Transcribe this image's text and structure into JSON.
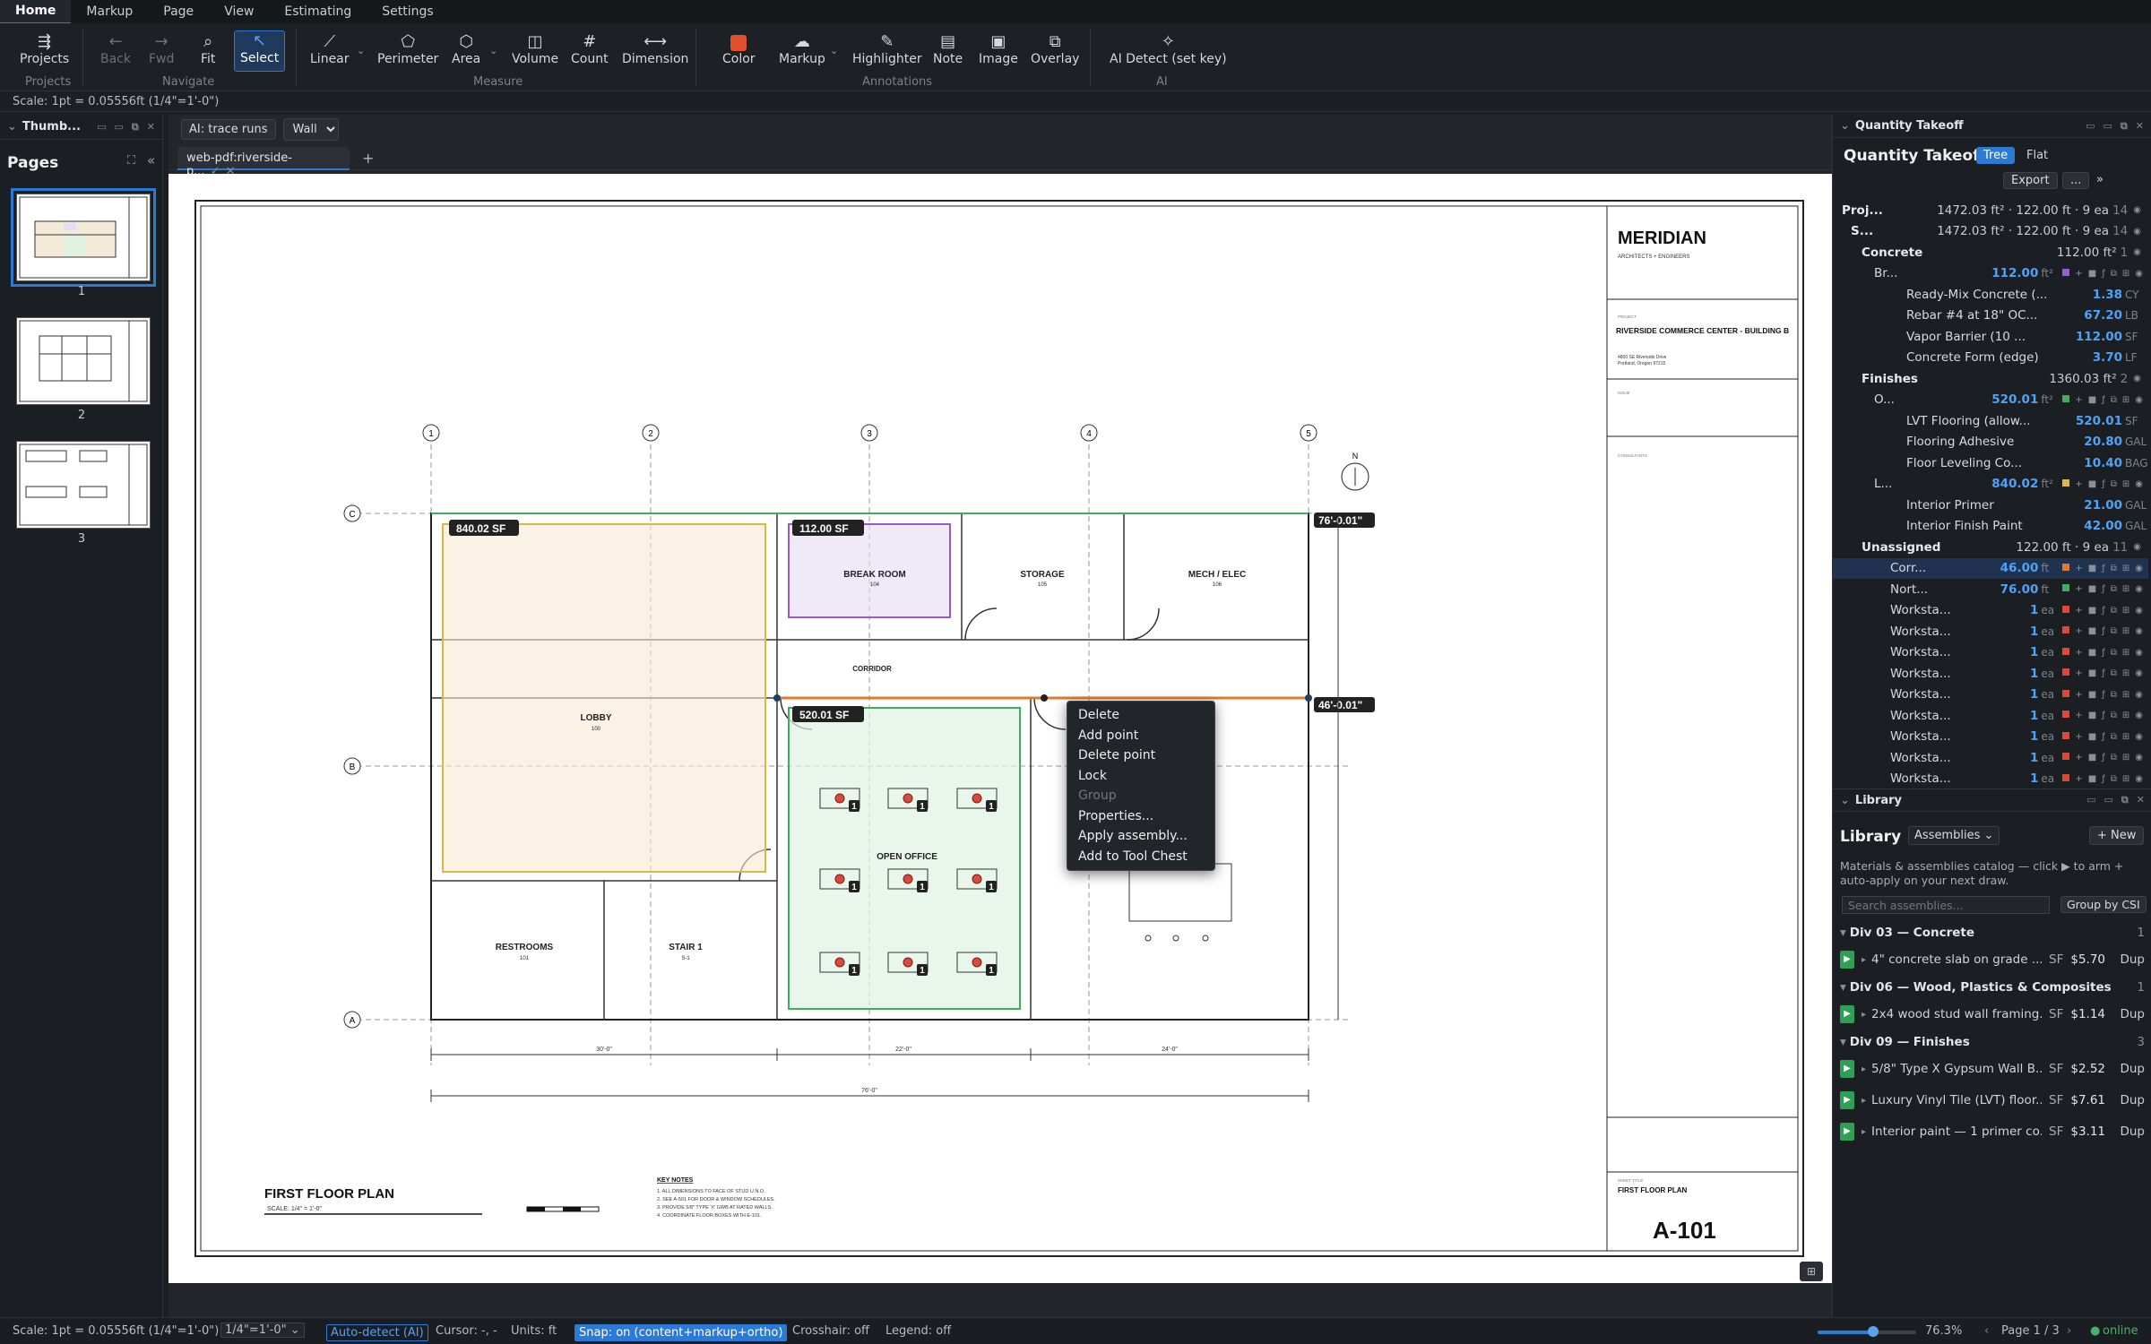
{
  "menu": [
    "Home",
    "Markup",
    "Page",
    "View",
    "Estimating",
    "Settings"
  ],
  "ribbon": {
    "projects": "Projects",
    "back": "Back",
    "fwd": "Fwd",
    "fit": "Fit",
    "select": "Select",
    "linear": "Linear",
    "perimeter": "Perimeter",
    "area": "Area",
    "volume": "Volume",
    "count": "Count",
    "dimension": "Dimension",
    "color": "Color",
    "markup": "Markup",
    "highlighter": "Highlighter",
    "note": "Note",
    "image": "Image",
    "overlay": "Overlay",
    "ai_detect": "AI Detect (set key)",
    "groups": {
      "projects": "Projects",
      "navigate": "Navigate",
      "measure": "Measure",
      "annotations": "Annotations",
      "ai": "AI"
    }
  },
  "scale_line": "Scale: 1pt = 0.05556ft (1/4\"=1'-0\")",
  "left_panel": {
    "title": "Thumb...",
    "pages_title": "Pages",
    "pages": [
      "1",
      "2",
      "3"
    ]
  },
  "viewer": {
    "ai_button": "AI: trace runs",
    "wall_select": "Wall",
    "tab_label": "web-pdf:riverside-p...",
    "measurements": {
      "lobby": "840.02 SF",
      "breakroom": "112.00 SF",
      "openoffice": "520.01 SF",
      "dim_top": "76'-0.01\"",
      "dim_mid": "46'-0.01\""
    }
  },
  "plan": {
    "grid_cols": [
      "1",
      "2",
      "3",
      "4",
      "5"
    ],
    "grid_rows": [
      "C",
      "B",
      "A"
    ],
    "rooms": {
      "lobby": "LOBBY",
      "lobby_no": "100",
      "breakroom": "BREAK ROOM",
      "breakroom_no": "104",
      "storage": "STORAGE",
      "storage_no": "105",
      "mech": "MECH / ELEC",
      "mech_no": "106",
      "corridor": "CORRIDOR",
      "openoffice": "OPEN OFFICE",
      "restrooms": "RESTROOMS",
      "restrooms_no": "101",
      "stair": "STAIR 1",
      "stair_no": "S-1"
    },
    "dims": {
      "d1": "30'-0\"",
      "d2": "22'-0\"",
      "d3": "24'-0\"",
      "total": "76'-0\""
    },
    "title": "FIRST FLOOR PLAN",
    "scale": "SCALE: 1/4\" = 1'-0\"",
    "key_notes_title": "KEY NOTES",
    "key_notes": [
      "1. ALL DIMENSIONS TO FACE OF STUD U.N.O.",
      "2. SEE A-501 FOR DOOR & WINDOW SCHEDULES.",
      "3. PROVIDE 5/8\" TYPE 'X' GWB AT RATED WALLS.",
      "4. COORDINATE FLOOR BOXES WITH E-101."
    ],
    "workstation_count": "1",
    "north": "N"
  },
  "titleblock": {
    "firm": "MERIDIAN",
    "firm_sub": "ARCHITECTS + ENGINEERS",
    "project_label": "PROJECT",
    "project": "RIVERSIDE COMMERCE CENTER - BUILDING B",
    "project_addr": "4800 SE Riverside Drive",
    "project_city": "Portland, Oregon 97215",
    "issue_label": "ISSUE",
    "consultants_label": "CONSULTANTS",
    "sheet_title_label": "SHEET TITLE",
    "sheet_title": "FIRST FLOOR PLAN",
    "sheet_no": "A-101"
  },
  "context_menu": [
    "Delete",
    "Add point",
    "Delete point",
    "Lock",
    "Group",
    "Properties...",
    "Apply assembly...",
    "Add to Tool Chest"
  ],
  "status": {
    "scale": "Scale: 1pt = 0.05556ft (1/4\"=1'-0\")",
    "scale_select": "1/4\"=1'-0\"",
    "auto_detect": "Auto-detect (AI)",
    "cursor": "Cursor: -, -",
    "units": "Units: ft",
    "snap": "Snap: on (content+markup+ortho)",
    "crosshair": "Crosshair: off",
    "legend": "Legend: off",
    "zoom": "76.3%",
    "page": "Page 1 / 3",
    "online": "online"
  },
  "takeoff": {
    "panel_title": "Quantity Takeoff",
    "title": "Quantity Takeoff",
    "tree": "Tree",
    "flat": "Flat",
    "export": "Export",
    "more": "...",
    "rows": [
      {
        "lbl": "Proj...",
        "sum": "1472.03 ft² · 122.00 ft · 9 ea",
        "n": "14",
        "ind": 10,
        "bold": true
      },
      {
        "lbl": "S...",
        "sum": "1472.03 ft² · 122.00 ft · 9 ea",
        "n": "14",
        "ind": 20,
        "bold": true
      },
      {
        "lbl": "Concrete",
        "sum": "112.00 ft²",
        "n": "1",
        "ind": 32,
        "bold": true
      },
      {
        "lbl": "Br...",
        "val": "112.00",
        "unit": "ft²",
        "ind": 46,
        "color": "#9b59d0"
      },
      {
        "lbl": "Ready-Mix Concrete (...",
        "val": "1.38",
        "unit": "CY",
        "ind": 82
      },
      {
        "lbl": "Rebar #4 at 18\" OC...",
        "val": "67.20",
        "unit": "LB",
        "ind": 82
      },
      {
        "lbl": "Vapor Barrier (10 ...",
        "val": "112.00",
        "unit": "SF",
        "ind": 82
      },
      {
        "lbl": "Concrete Form (edge)",
        "val": "3.70",
        "unit": "LF",
        "ind": 82
      },
      {
        "lbl": "Finishes",
        "sum": "1360.03 ft²",
        "n": "2",
        "ind": 32,
        "bold": true
      },
      {
        "lbl": "O...",
        "val": "520.01",
        "unit": "ft²",
        "ind": 46,
        "color": "#3fae5a"
      },
      {
        "lbl": "LVT Flooring (allow...",
        "val": "520.01",
        "unit": "SF",
        "ind": 82
      },
      {
        "lbl": "Flooring Adhesive",
        "val": "20.80",
        "unit": "GAL",
        "ind": 82
      },
      {
        "lbl": "Floor Leveling Co...",
        "val": "10.40",
        "unit": "BAG",
        "ind": 82
      },
      {
        "lbl": "L...",
        "val": "840.02",
        "unit": "ft²",
        "ind": 46,
        "color": "#e0b640"
      },
      {
        "lbl": "Interior Primer",
        "val": "21.00",
        "unit": "GAL",
        "ind": 82
      },
      {
        "lbl": "Interior Finish Paint",
        "val": "42.00",
        "unit": "GAL",
        "ind": 82
      },
      {
        "lbl": "Unassigned",
        "sum": "122.00 ft · 9 ea",
        "n": "11",
        "ind": 32,
        "bold": true
      },
      {
        "lbl": "Corr...",
        "val": "46.00",
        "unit": "ft",
        "ind": 64,
        "color": "#e07a2e",
        "sel": true
      },
      {
        "lbl": "Nort...",
        "val": "76.00",
        "unit": "ft",
        "ind": 64,
        "color": "#3fae5a"
      },
      {
        "lbl": "Worksta...",
        "val": "1",
        "unit": "ea",
        "ind": 64,
        "color": "#d94a3a"
      },
      {
        "lbl": "Worksta...",
        "val": "1",
        "unit": "ea",
        "ind": 64,
        "color": "#d94a3a"
      },
      {
        "lbl": "Worksta...",
        "val": "1",
        "unit": "ea",
        "ind": 64,
        "color": "#d94a3a"
      },
      {
        "lbl": "Worksta...",
        "val": "1",
        "unit": "ea",
        "ind": 64,
        "color": "#d94a3a"
      },
      {
        "lbl": "Worksta...",
        "val": "1",
        "unit": "ea",
        "ind": 64,
        "color": "#d94a3a"
      },
      {
        "lbl": "Worksta...",
        "val": "1",
        "unit": "ea",
        "ind": 64,
        "color": "#d94a3a"
      },
      {
        "lbl": "Worksta...",
        "val": "1",
        "unit": "ea",
        "ind": 64,
        "color": "#d94a3a"
      },
      {
        "lbl": "Worksta...",
        "val": "1",
        "unit": "ea",
        "ind": 64,
        "color": "#d94a3a"
      },
      {
        "lbl": "Worksta...",
        "val": "1",
        "unit": "ea",
        "ind": 64,
        "color": "#d94a3a"
      }
    ]
  },
  "library": {
    "panel_title": "Library",
    "title": "Library",
    "select": "Assemblies",
    "new": "+ New",
    "desc": "Materials & assemblies catalog — click ▶ to arm + auto-apply on your next draw.",
    "search_placeholder": "Search assemblies...",
    "group_by": "Group by CSI",
    "divs": [
      {
        "name": "Div 03 — Concrete",
        "n": "1",
        "items": [
          {
            "name": "4\" concrete slab on grade ...",
            "unit": "SF",
            "price": "$5.70"
          }
        ]
      },
      {
        "name": "Div 06 — Wood, Plastics & Composites",
        "n": "1",
        "items": [
          {
            "name": "2x4 wood stud wall framing...",
            "unit": "SF",
            "price": "$1.14"
          }
        ]
      },
      {
        "name": "Div 09 — Finishes",
        "n": "3",
        "items": [
          {
            "name": "5/8\" Type X Gypsum Wall B...",
            "unit": "SF",
            "price": "$2.52"
          },
          {
            "name": "Luxury Vinyl Tile (LVT) floor...",
            "unit": "SF",
            "price": "$7.61"
          },
          {
            "name": "Interior paint — 1 primer co...",
            "unit": "SF",
            "price": "$3.11"
          }
        ]
      }
    ],
    "dup": "Dup"
  },
  "colors": {
    "accent": "#2b7bd6",
    "lobby": "#e0b640",
    "breakroom": "#9b59d0",
    "openoffice": "#3fae5a",
    "corridor": "#e07a2e",
    "workstation": "#d94a3a"
  }
}
